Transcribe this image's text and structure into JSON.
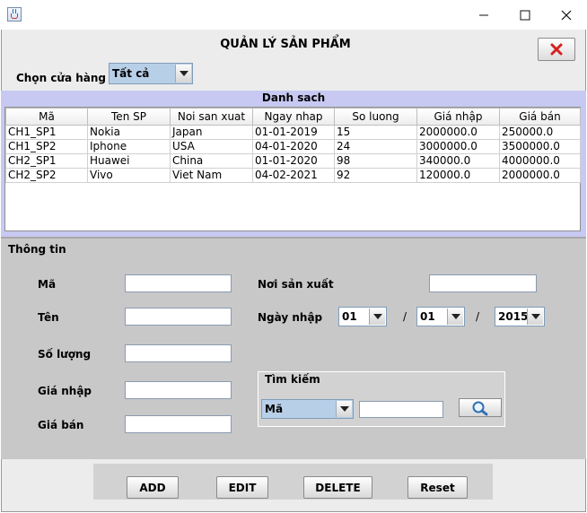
{
  "window": {
    "title": "",
    "icon": "java-cup-icon",
    "controls": [
      "minimize",
      "maximize",
      "close"
    ]
  },
  "header": {
    "title": "QUẢN LÝ SẢN PHẨM",
    "close_button_icon": "red-x-icon"
  },
  "store": {
    "label": "Chọn cửa hàng",
    "selected": "Tất cả"
  },
  "list": {
    "title": "Danh sach",
    "columns": [
      "Mã",
      "Ten SP",
      "Noi san xuat",
      "Ngay nhap",
      "So luong",
      "Giá nhập",
      "Giá bán"
    ],
    "rows": [
      [
        "CH1_SP1",
        "Nokia",
        "Japan",
        "01-01-2019",
        "15",
        "2000000.0",
        "250000.0"
      ],
      [
        "CH1_SP2",
        "Iphone",
        "USA",
        "04-01-2020",
        "24",
        "3000000.0",
        "3500000.0"
      ],
      [
        "CH2_SP1",
        "Huawei",
        "China",
        "01-01-2020",
        "98",
        "340000.0",
        "4000000.0"
      ],
      [
        "CH2_SP2",
        "Vivo",
        "Viet Nam",
        "04-02-2021",
        "92",
        "120000.0",
        "2000000.0"
      ]
    ]
  },
  "info": {
    "title": "Thông tin",
    "labels": {
      "ma": "Mã",
      "ten": "Tên",
      "so_luong": "Số lượng",
      "gia_nhap": "Giá nhập",
      "gia_ban": "Giá bán",
      "noi_san_xuat": "Nơi sản xuất",
      "ngay_nhap": "Ngày nhập"
    },
    "date": {
      "day": "01",
      "month": "01",
      "year": "2015",
      "separator": "/"
    }
  },
  "search": {
    "legend": "Tìm kiếm",
    "field_selected": "Mã",
    "button_icon": "magnifier-icon"
  },
  "actions": {
    "add": "ADD",
    "edit": "EDIT",
    "delete": "DELETE",
    "reset": "Reset"
  },
  "colors": {
    "list_panel": "#c7c9f2",
    "info_panel": "#c8c8c8",
    "combo_bg": "#b8cfe8",
    "close_icon": "#d62020"
  }
}
